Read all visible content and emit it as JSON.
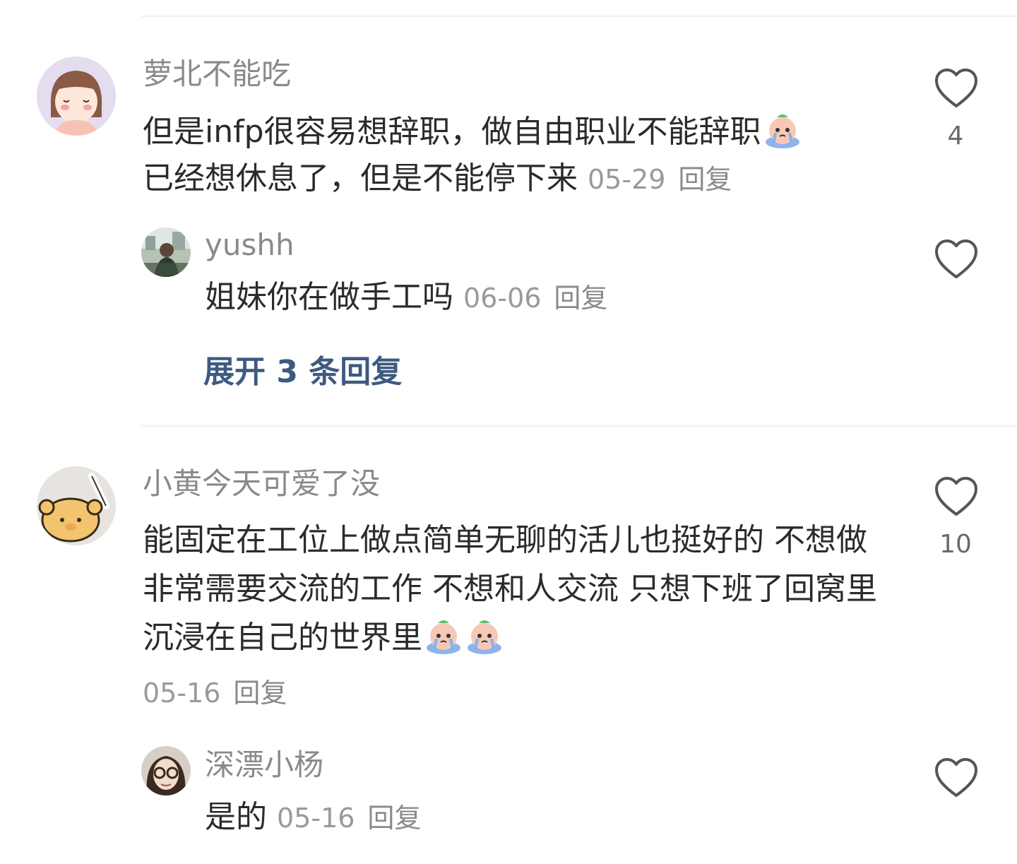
{
  "comments": [
    {
      "username": "萝北不能吃",
      "content_line1": "但是infp很容易想辞职，做自由职业不能辞职",
      "content_line2": "已经想休息了，但是不能停下来",
      "date": "05-29",
      "reply_label": "回复",
      "likes": "4",
      "emoji": "crying-emoji"
    },
    {
      "username": "小黄今天可爱了没",
      "content": "能固定在工位上做点简单无聊的活儿也挺好的 不想做非常需要交流的工作 不想和人交流 只想下班了回窝里沉浸在自己的世界里",
      "date": "05-16",
      "reply_label": "回复",
      "likes": "10",
      "emoji": "crying-emoji"
    }
  ],
  "replies": [
    {
      "username": "yushh",
      "content": "姐妹你在做手工吗",
      "date": "06-06",
      "reply_label": "回复"
    },
    {
      "username": "深漂小杨",
      "content": "是的",
      "date": "05-16",
      "reply_label": "回复"
    }
  ],
  "expand_replies": "展开 3 条回复",
  "watermark": "",
  "colors": {
    "username": "#8a8a8a",
    "text": "#2b2b2b",
    "meta": "#9a9a9a",
    "expand": "#3d5a80",
    "heart": "#555555"
  }
}
